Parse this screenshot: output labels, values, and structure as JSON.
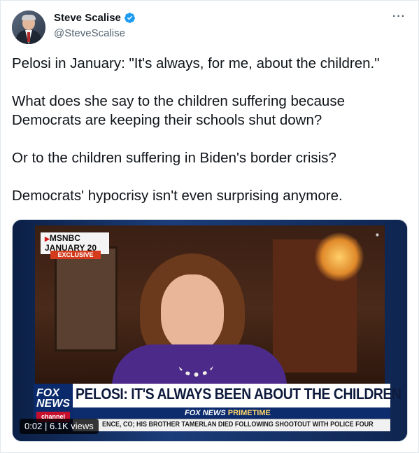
{
  "author": {
    "display_name": "Steve Scalise",
    "handle": "@SteveScalise",
    "avatar_icon": "avatar-portrait",
    "verified_icon": "verified-badge-icon"
  },
  "more_icon": "···",
  "tweet": {
    "paragraphs": [
      "Pelosi in January: \"It's always, for me, about the children.\"",
      "What does she say to the children suffering because Democrats are keeping their schools shut down?",
      "Or to the children suffering in Biden's border crisis?",
      "Democrats' hypocrisy isn't even surprising anymore."
    ],
    "paragraph2_line1": "What does she say to the children suffering because",
    "paragraph2_line2": "Democrats are keeping their schools shut down?"
  },
  "video": {
    "msnbc_line1": "MSNBC",
    "msnbc_line2": "JANUARY 20",
    "exclusive": "EXCLUSIVE",
    "fox_line1": "FOX",
    "fox_line2": "NEWS",
    "fox_channel": "channel",
    "headline": "PELOSI: IT'S ALWAYS BEEN ABOUT THE CHILDREN",
    "sub_title_brand": "FOX NEWS",
    "sub_title_show": "PRIMETIME",
    "ticker": "ENCE, CO; HIS BROTHER TAMERLAN DIED FOLLOWING SHOOTOUT WITH POLICE FOUR",
    "time": "0:02",
    "views": "6.1K views",
    "accent_colors": {
      "fox_blue": "#0a2a6c",
      "fox_red": "#c8102e",
      "verified_blue": "#1d9bf0"
    }
  }
}
